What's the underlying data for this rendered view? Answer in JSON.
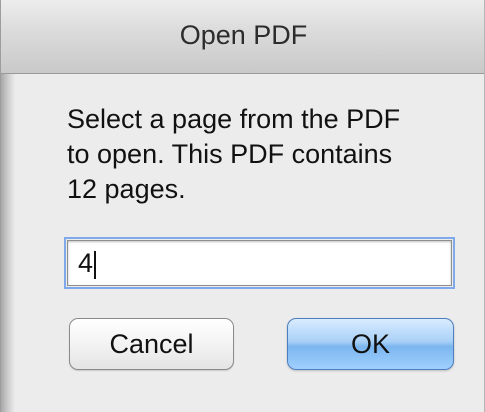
{
  "dialog": {
    "title": "Open PDF",
    "message_lines": "Select a page from the PDF\nto open. This PDF contains\n12 pages.",
    "input_value": "4",
    "cancel_label": "Cancel",
    "ok_label": "OK"
  },
  "colors": {
    "window_background": "#ececec",
    "titlebar_gradient_top": "#ededed",
    "titlebar_gradient_bottom": "#c9c9c9",
    "default_button_blue": "#7cb6ef",
    "focus_ring": "#7fa9e8"
  }
}
